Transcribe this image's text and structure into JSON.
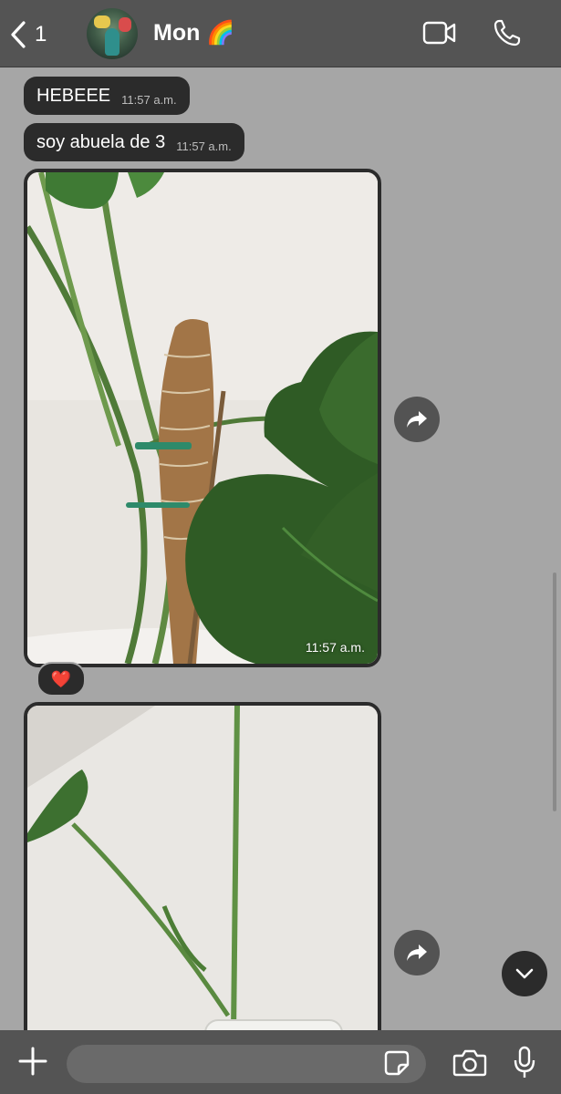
{
  "header": {
    "back_count": "1",
    "contact_name": "Mon 🌈"
  },
  "messages": [
    {
      "text": "HEBEEE",
      "time": "11:57 a.m."
    },
    {
      "text": "soy abuela de 3",
      "time": "11:57 a.m."
    }
  ],
  "photos": [
    {
      "time": "11:57 a.m.",
      "reaction": "❤️"
    },
    {
      "time": ""
    }
  ],
  "composer": {
    "placeholder": ""
  },
  "colors": {
    "background": "#a6a6a6",
    "bar": "#545454",
    "bubble": "#2b2b2b"
  },
  "icons": [
    "back-chevron-icon",
    "video-call-icon",
    "phone-icon",
    "forward-icon",
    "chevron-down-icon",
    "plus-icon",
    "sticker-icon",
    "camera-icon",
    "mic-icon"
  ]
}
